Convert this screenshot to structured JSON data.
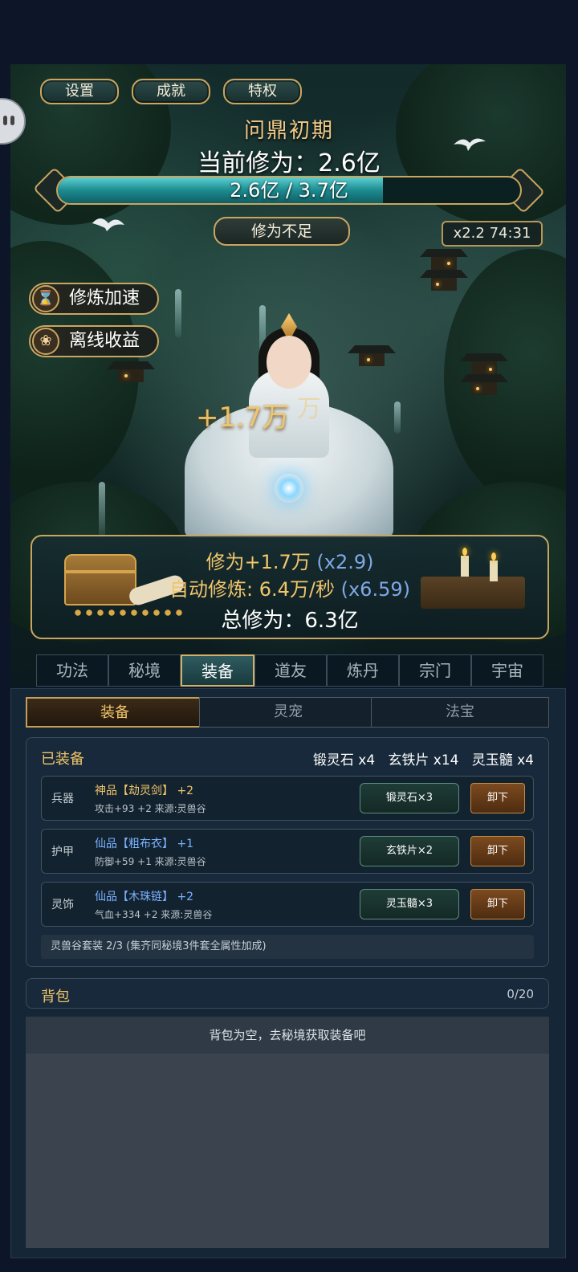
{
  "top_buttons": [
    "设置",
    "成就",
    "特权"
  ],
  "realm": "问鼎初期",
  "cultivation": "当前修为：2.6亿",
  "progress": {
    "label": "2.6亿 / 3.7亿",
    "current": 2.6,
    "max": 3.7
  },
  "status_button": "修为不足",
  "multiplier": "x2.2 74:31",
  "side_buttons": [
    {
      "label": "修炼加速",
      "icon": "hourglass-icon"
    },
    {
      "label": "离线收益",
      "icon": "lotus-icon"
    }
  ],
  "float_gain": "+1.7万",
  "float_gain_faded": "万",
  "panel": {
    "gain_label": "修为+1.7万",
    "gain_mult": "(x2.9)",
    "auto_label": "自动修炼: 6.4万/秒",
    "auto_mult": "(x6.59)",
    "total": "总修为：6.3亿"
  },
  "main_tabs": [
    "功法",
    "秘境",
    "装备",
    "道友",
    "炼丹",
    "宗门",
    "宇宙"
  ],
  "active_tab": "装备",
  "sub_tabs": [
    "装备",
    "灵宠",
    "法宝"
  ],
  "equipped": {
    "title": "已装备",
    "materials": "锻灵石 x4   玄铁片 x14   灵玉髓 x4",
    "slots": [
      {
        "type": "兵器",
        "name": "神品【劫灵剑】 +2",
        "stat": "攻击+93 +2  来源:灵兽谷",
        "mat": "锻灵石×3",
        "unequip": "卸下"
      },
      {
        "type": "护甲",
        "name": "仙品【粗布衣】 +1",
        "stat": "防御+59 +1  来源:灵兽谷",
        "mat": "玄铁片×2",
        "unequip": "卸下"
      },
      {
        "type": "灵饰",
        "name": "仙品【木珠链】 +2",
        "stat": "气血+334 +2  来源:灵兽谷",
        "mat": "灵玉髓×3",
        "unequip": "卸下"
      }
    ],
    "set_bonus": "灵兽谷套装  2/3 (集齐同秘境3件套全属性加成)"
  },
  "bag": {
    "title": "背包",
    "count": "0/20",
    "empty_text": "背包为空，去秘境获取装备吧"
  },
  "colors": {
    "gold": "#c9a660",
    "divine": "#f1c56a",
    "immortal": "#7ab2ff",
    "progress": "#1c8b8f"
  }
}
